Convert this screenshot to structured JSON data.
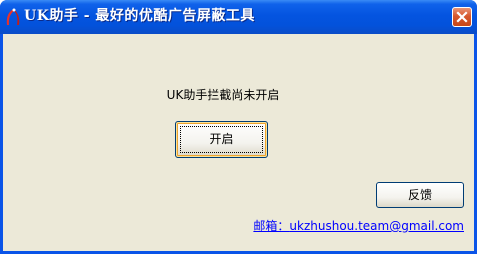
{
  "window": {
    "title": "UK助手 - 最好的优酷广告屏蔽工具",
    "close_icon": "close-icon",
    "app_icon": "app-logo-icon"
  },
  "main": {
    "status": "UK助手拦截尚未开启",
    "start_button": "开启",
    "feedback_button": "反馈",
    "email_label": "邮箱：",
    "email": "ukzhushou.team@gmail.com"
  },
  "colors": {
    "titlebar": "#0454e0",
    "client_bg": "#ece9d8",
    "close_button": "#d6582e",
    "link": "#0000ff",
    "button_border": "#003c74"
  }
}
